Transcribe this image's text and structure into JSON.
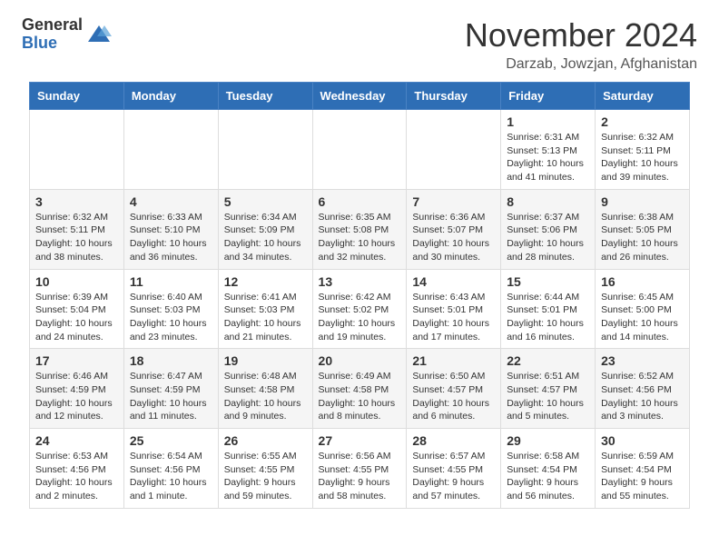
{
  "logo": {
    "general": "General",
    "blue": "Blue"
  },
  "title": "November 2024",
  "location": "Darzab, Jowzjan, Afghanistan",
  "days_of_week": [
    "Sunday",
    "Monday",
    "Tuesday",
    "Wednesday",
    "Thursday",
    "Friday",
    "Saturday"
  ],
  "weeks": [
    [
      {
        "day": "",
        "content": ""
      },
      {
        "day": "",
        "content": ""
      },
      {
        "day": "",
        "content": ""
      },
      {
        "day": "",
        "content": ""
      },
      {
        "day": "",
        "content": ""
      },
      {
        "day": "1",
        "content": "Sunrise: 6:31 AM\nSunset: 5:13 PM\nDaylight: 10 hours and 41 minutes."
      },
      {
        "day": "2",
        "content": "Sunrise: 6:32 AM\nSunset: 5:11 PM\nDaylight: 10 hours and 39 minutes."
      }
    ],
    [
      {
        "day": "3",
        "content": "Sunrise: 6:32 AM\nSunset: 5:11 PM\nDaylight: 10 hours and 38 minutes."
      },
      {
        "day": "4",
        "content": "Sunrise: 6:33 AM\nSunset: 5:10 PM\nDaylight: 10 hours and 36 minutes."
      },
      {
        "day": "5",
        "content": "Sunrise: 6:34 AM\nSunset: 5:09 PM\nDaylight: 10 hours and 34 minutes."
      },
      {
        "day": "6",
        "content": "Sunrise: 6:35 AM\nSunset: 5:08 PM\nDaylight: 10 hours and 32 minutes."
      },
      {
        "day": "7",
        "content": "Sunrise: 6:36 AM\nSunset: 5:07 PM\nDaylight: 10 hours and 30 minutes."
      },
      {
        "day": "8",
        "content": "Sunrise: 6:37 AM\nSunset: 5:06 PM\nDaylight: 10 hours and 28 minutes."
      },
      {
        "day": "9",
        "content": "Sunrise: 6:38 AM\nSunset: 5:05 PM\nDaylight: 10 hours and 26 minutes."
      }
    ],
    [
      {
        "day": "10",
        "content": "Sunrise: 6:39 AM\nSunset: 5:04 PM\nDaylight: 10 hours and 24 minutes."
      },
      {
        "day": "11",
        "content": "Sunrise: 6:40 AM\nSunset: 5:03 PM\nDaylight: 10 hours and 23 minutes."
      },
      {
        "day": "12",
        "content": "Sunrise: 6:41 AM\nSunset: 5:03 PM\nDaylight: 10 hours and 21 minutes."
      },
      {
        "day": "13",
        "content": "Sunrise: 6:42 AM\nSunset: 5:02 PM\nDaylight: 10 hours and 19 minutes."
      },
      {
        "day": "14",
        "content": "Sunrise: 6:43 AM\nSunset: 5:01 PM\nDaylight: 10 hours and 17 minutes."
      },
      {
        "day": "15",
        "content": "Sunrise: 6:44 AM\nSunset: 5:01 PM\nDaylight: 10 hours and 16 minutes."
      },
      {
        "day": "16",
        "content": "Sunrise: 6:45 AM\nSunset: 5:00 PM\nDaylight: 10 hours and 14 minutes."
      }
    ],
    [
      {
        "day": "17",
        "content": "Sunrise: 6:46 AM\nSunset: 4:59 PM\nDaylight: 10 hours and 12 minutes."
      },
      {
        "day": "18",
        "content": "Sunrise: 6:47 AM\nSunset: 4:59 PM\nDaylight: 10 hours and 11 minutes."
      },
      {
        "day": "19",
        "content": "Sunrise: 6:48 AM\nSunset: 4:58 PM\nDaylight: 10 hours and 9 minutes."
      },
      {
        "day": "20",
        "content": "Sunrise: 6:49 AM\nSunset: 4:58 PM\nDaylight: 10 hours and 8 minutes."
      },
      {
        "day": "21",
        "content": "Sunrise: 6:50 AM\nSunset: 4:57 PM\nDaylight: 10 hours and 6 minutes."
      },
      {
        "day": "22",
        "content": "Sunrise: 6:51 AM\nSunset: 4:57 PM\nDaylight: 10 hours and 5 minutes."
      },
      {
        "day": "23",
        "content": "Sunrise: 6:52 AM\nSunset: 4:56 PM\nDaylight: 10 hours and 3 minutes."
      }
    ],
    [
      {
        "day": "24",
        "content": "Sunrise: 6:53 AM\nSunset: 4:56 PM\nDaylight: 10 hours and 2 minutes."
      },
      {
        "day": "25",
        "content": "Sunrise: 6:54 AM\nSunset: 4:56 PM\nDaylight: 10 hours and 1 minute."
      },
      {
        "day": "26",
        "content": "Sunrise: 6:55 AM\nSunset: 4:55 PM\nDaylight: 9 hours and 59 minutes."
      },
      {
        "day": "27",
        "content": "Sunrise: 6:56 AM\nSunset: 4:55 PM\nDaylight: 9 hours and 58 minutes."
      },
      {
        "day": "28",
        "content": "Sunrise: 6:57 AM\nSunset: 4:55 PM\nDaylight: 9 hours and 57 minutes."
      },
      {
        "day": "29",
        "content": "Sunrise: 6:58 AM\nSunset: 4:54 PM\nDaylight: 9 hours and 56 minutes."
      },
      {
        "day": "30",
        "content": "Sunrise: 6:59 AM\nSunset: 4:54 PM\nDaylight: 9 hours and 55 minutes."
      }
    ]
  ],
  "accent_color": "#2e6eb5"
}
